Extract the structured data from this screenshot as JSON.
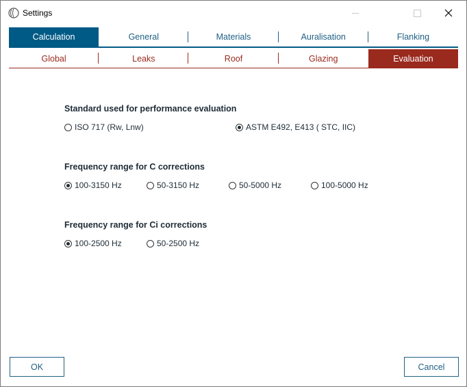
{
  "window": {
    "title": "Settings"
  },
  "tabs_primary": [
    {
      "label": "Calculation",
      "active": true
    },
    {
      "label": "General",
      "active": false
    },
    {
      "label": "Materials",
      "active": false
    },
    {
      "label": "Auralisation",
      "active": false
    },
    {
      "label": "Flanking",
      "active": false
    }
  ],
  "tabs_secondary": [
    {
      "label": "Global",
      "active": false
    },
    {
      "label": "Leaks",
      "active": false
    },
    {
      "label": "Roof",
      "active": false
    },
    {
      "label": "Glazing",
      "active": false
    },
    {
      "label": "Evaluation",
      "active": true
    }
  ],
  "standard": {
    "title": "Standard used for performance evaluation",
    "options": [
      {
        "label": "ISO 717 (Rw, Lnw)",
        "checked": false
      },
      {
        "label": "ASTM E492, E413 ( STC, IIC)",
        "checked": true
      }
    ]
  },
  "freq_c": {
    "title": "Frequency range for C corrections",
    "options": [
      {
        "label": "100-3150 Hz",
        "checked": true
      },
      {
        "label": "50-3150 Hz",
        "checked": false
      },
      {
        "label": "50-5000 Hz",
        "checked": false
      },
      {
        "label": "100-5000 Hz",
        "checked": false
      }
    ]
  },
  "freq_ci": {
    "title": "Frequency range for Ci corrections",
    "options": [
      {
        "label": "100-2500 Hz",
        "checked": true
      },
      {
        "label": "50-2500 Hz",
        "checked": false
      }
    ]
  },
  "buttons": {
    "ok": "OK",
    "cancel": "Cancel"
  },
  "colors": {
    "primary": "#005a86",
    "secondary": "#9a2a1e"
  }
}
